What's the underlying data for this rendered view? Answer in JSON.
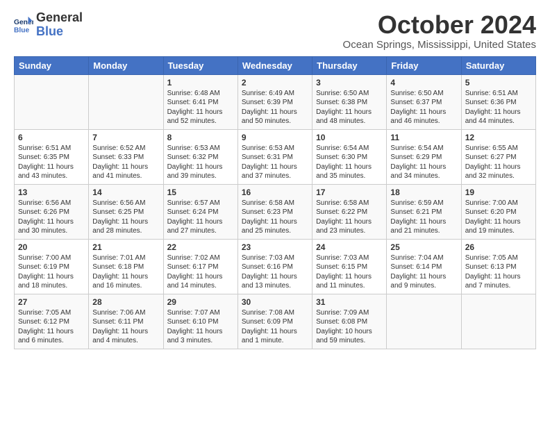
{
  "header": {
    "logo_line1": "General",
    "logo_line2": "Blue",
    "month": "October 2024",
    "location": "Ocean Springs, Mississippi, United States"
  },
  "weekdays": [
    "Sunday",
    "Monday",
    "Tuesday",
    "Wednesday",
    "Thursday",
    "Friday",
    "Saturday"
  ],
  "weeks": [
    [
      {
        "day": "",
        "info": ""
      },
      {
        "day": "",
        "info": ""
      },
      {
        "day": "1",
        "info": "Sunrise: 6:48 AM\nSunset: 6:41 PM\nDaylight: 11 hours and 52 minutes."
      },
      {
        "day": "2",
        "info": "Sunrise: 6:49 AM\nSunset: 6:39 PM\nDaylight: 11 hours and 50 minutes."
      },
      {
        "day": "3",
        "info": "Sunrise: 6:50 AM\nSunset: 6:38 PM\nDaylight: 11 hours and 48 minutes."
      },
      {
        "day": "4",
        "info": "Sunrise: 6:50 AM\nSunset: 6:37 PM\nDaylight: 11 hours and 46 minutes."
      },
      {
        "day": "5",
        "info": "Sunrise: 6:51 AM\nSunset: 6:36 PM\nDaylight: 11 hours and 44 minutes."
      }
    ],
    [
      {
        "day": "6",
        "info": "Sunrise: 6:51 AM\nSunset: 6:35 PM\nDaylight: 11 hours and 43 minutes."
      },
      {
        "day": "7",
        "info": "Sunrise: 6:52 AM\nSunset: 6:33 PM\nDaylight: 11 hours and 41 minutes."
      },
      {
        "day": "8",
        "info": "Sunrise: 6:53 AM\nSunset: 6:32 PM\nDaylight: 11 hours and 39 minutes."
      },
      {
        "day": "9",
        "info": "Sunrise: 6:53 AM\nSunset: 6:31 PM\nDaylight: 11 hours and 37 minutes."
      },
      {
        "day": "10",
        "info": "Sunrise: 6:54 AM\nSunset: 6:30 PM\nDaylight: 11 hours and 35 minutes."
      },
      {
        "day": "11",
        "info": "Sunrise: 6:54 AM\nSunset: 6:29 PM\nDaylight: 11 hours and 34 minutes."
      },
      {
        "day": "12",
        "info": "Sunrise: 6:55 AM\nSunset: 6:27 PM\nDaylight: 11 hours and 32 minutes."
      }
    ],
    [
      {
        "day": "13",
        "info": "Sunrise: 6:56 AM\nSunset: 6:26 PM\nDaylight: 11 hours and 30 minutes."
      },
      {
        "day": "14",
        "info": "Sunrise: 6:56 AM\nSunset: 6:25 PM\nDaylight: 11 hours and 28 minutes."
      },
      {
        "day": "15",
        "info": "Sunrise: 6:57 AM\nSunset: 6:24 PM\nDaylight: 11 hours and 27 minutes."
      },
      {
        "day": "16",
        "info": "Sunrise: 6:58 AM\nSunset: 6:23 PM\nDaylight: 11 hours and 25 minutes."
      },
      {
        "day": "17",
        "info": "Sunrise: 6:58 AM\nSunset: 6:22 PM\nDaylight: 11 hours and 23 minutes."
      },
      {
        "day": "18",
        "info": "Sunrise: 6:59 AM\nSunset: 6:21 PM\nDaylight: 11 hours and 21 minutes."
      },
      {
        "day": "19",
        "info": "Sunrise: 7:00 AM\nSunset: 6:20 PM\nDaylight: 11 hours and 19 minutes."
      }
    ],
    [
      {
        "day": "20",
        "info": "Sunrise: 7:00 AM\nSunset: 6:19 PM\nDaylight: 11 hours and 18 minutes."
      },
      {
        "day": "21",
        "info": "Sunrise: 7:01 AM\nSunset: 6:18 PM\nDaylight: 11 hours and 16 minutes."
      },
      {
        "day": "22",
        "info": "Sunrise: 7:02 AM\nSunset: 6:17 PM\nDaylight: 11 hours and 14 minutes."
      },
      {
        "day": "23",
        "info": "Sunrise: 7:03 AM\nSunset: 6:16 PM\nDaylight: 11 hours and 13 minutes."
      },
      {
        "day": "24",
        "info": "Sunrise: 7:03 AM\nSunset: 6:15 PM\nDaylight: 11 hours and 11 minutes."
      },
      {
        "day": "25",
        "info": "Sunrise: 7:04 AM\nSunset: 6:14 PM\nDaylight: 11 hours and 9 minutes."
      },
      {
        "day": "26",
        "info": "Sunrise: 7:05 AM\nSunset: 6:13 PM\nDaylight: 11 hours and 7 minutes."
      }
    ],
    [
      {
        "day": "27",
        "info": "Sunrise: 7:05 AM\nSunset: 6:12 PM\nDaylight: 11 hours and 6 minutes."
      },
      {
        "day": "28",
        "info": "Sunrise: 7:06 AM\nSunset: 6:11 PM\nDaylight: 11 hours and 4 minutes."
      },
      {
        "day": "29",
        "info": "Sunrise: 7:07 AM\nSunset: 6:10 PM\nDaylight: 11 hours and 3 minutes."
      },
      {
        "day": "30",
        "info": "Sunrise: 7:08 AM\nSunset: 6:09 PM\nDaylight: 11 hours and 1 minute."
      },
      {
        "day": "31",
        "info": "Sunrise: 7:09 AM\nSunset: 6:08 PM\nDaylight: 10 hours and 59 minutes."
      },
      {
        "day": "",
        "info": ""
      },
      {
        "day": "",
        "info": ""
      }
    ]
  ]
}
